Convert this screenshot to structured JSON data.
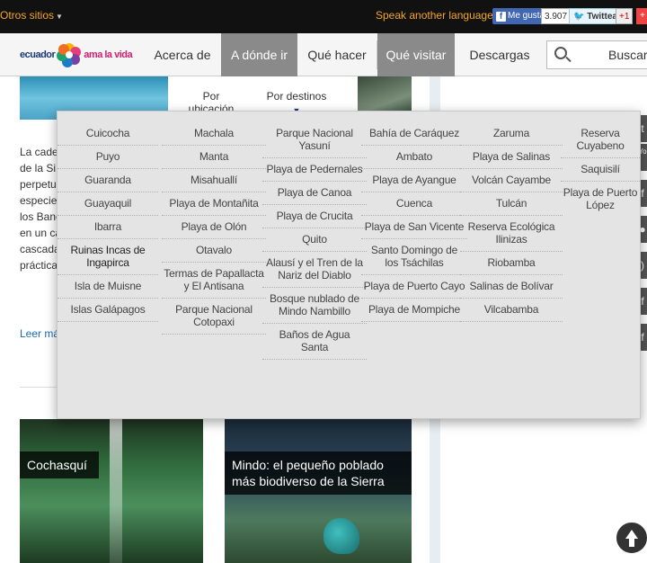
{
  "topbar": {
    "otros_sitios": "Otros sitios",
    "speak": "Speak another language?",
    "fb_like": "Me gusta",
    "fb_count": "3.907",
    "twitter": "Twittear",
    "gplus": "+1"
  },
  "header": {
    "logo_word1": "ecuador",
    "logo_word2": "ama la vida",
    "nav": [
      "Acerca de",
      "A dónde ir",
      "Qué hacer",
      "Qué visitar",
      "Descargas"
    ],
    "search_label": "Buscar"
  },
  "subtabs": {
    "ubicacion": "Por ubicación",
    "destinos": "Por destinos"
  },
  "body": {
    "lines": [
      "La caden",
      "de la Si",
      "perpetuo",
      "especies",
      "los Banco",
      "en un cál",
      "cascadas",
      "práctica d"
    ],
    "leer_mas": "Leer más"
  },
  "cards": [
    {
      "caption": "Cochasquí"
    },
    {
      "caption": "Mindo: el pequeño poblado más biodiverso de la Sierra"
    }
  ],
  "mega_menu": {
    "columns": [
      [
        "Cuicocha",
        "Puyo",
        "Guaranda",
        "Guayaquil",
        "Ibarra",
        "Ruinas Incas de Ingapirca",
        "Isla de Muisne",
        "Islas Galápagos"
      ],
      [
        "Machala",
        "Manta",
        "Misahuallí",
        "Playa de Montañita",
        "Playa de Olón",
        "Otavalo",
        "Termas de Papallacta y El Antisana",
        "Parque Nacional Cotopaxi"
      ],
      [
        "Parque Nacional Yasuní",
        "Playa de Pedernales",
        "Playa de Canoa",
        "Playa de Crucita",
        "Quito",
        "Alausí y el Tren de la Nariz del Diablo",
        "Bosque nublado de Mindo Nambillo",
        "Baños de Agua Santa"
      ],
      [
        "Bahía de Caráquez",
        "Ambato",
        "Playa de Ayangue",
        "Cuenca",
        "Playa de San Vicente",
        "Santo Domingo de los Tsáchilas",
        "Playa de Puerto Cayo",
        "Playa de Mompiche"
      ],
      [
        "Zaruma",
        "Playa de Salinas",
        "Volcán Cayambe",
        "Tulcán",
        "Reserva Ecológica Ilinizas",
        "Riobamba",
        "Salinas de Bolívar",
        "Vilcabamba"
      ],
      [
        "Reserva Cuyabeno",
        "Saquisilí",
        "Playa de Puerto López"
      ]
    ]
  },
  "social_icons": [
    "twitter-icon",
    "youtube-icon",
    "facebook-icon",
    "flickr-icon",
    "rss-icon",
    "facebook-icon",
    "facebook-icon"
  ],
  "colors": {
    "topbar_bg": "#111111",
    "accent_orange": "#f5a623",
    "nav_active_bg": "#8a8a8a",
    "link_blue": "#1a6bb2"
  }
}
